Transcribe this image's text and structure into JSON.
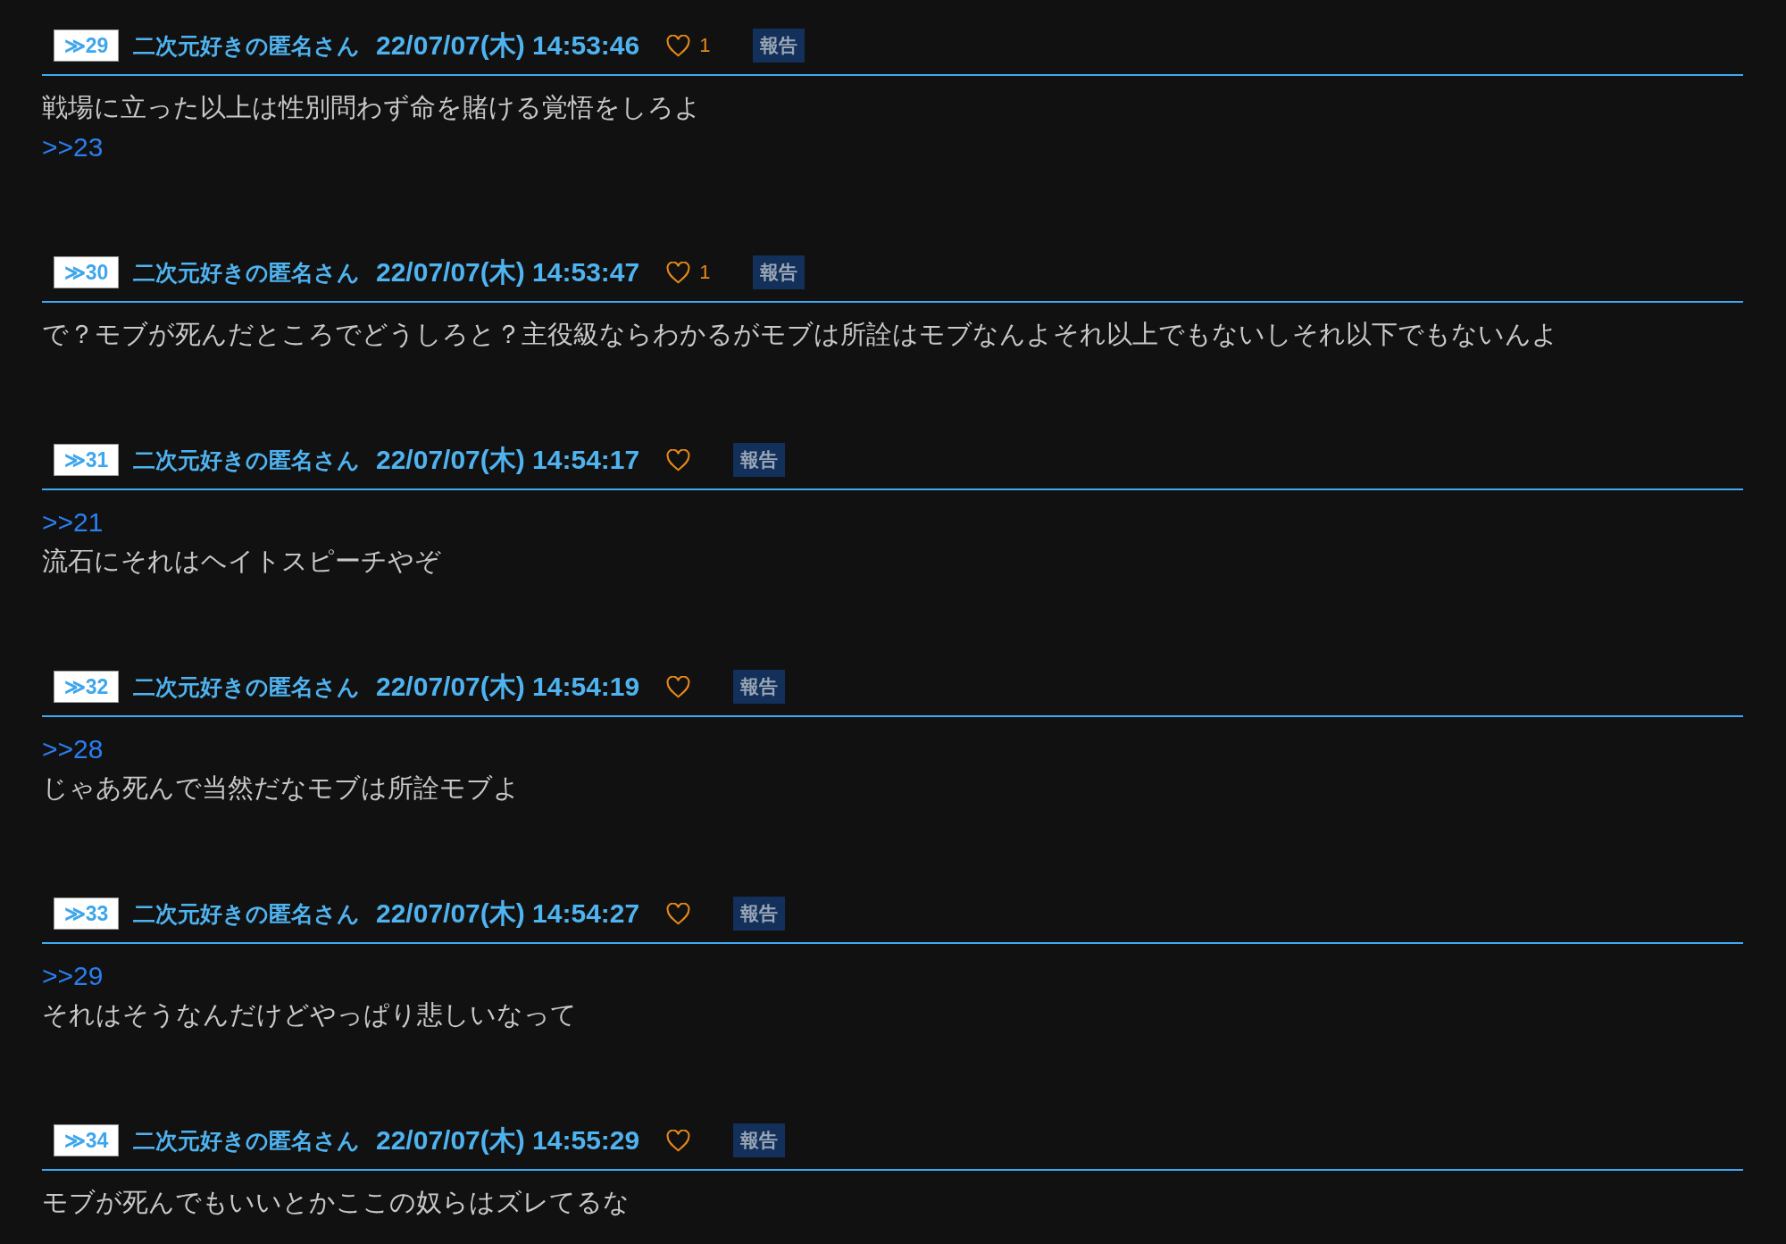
{
  "posts": [
    {
      "number": "≫29",
      "name": "二次元好きの匿名さん",
      "date": "22/07/07(木) 14:53:46",
      "likes": "1",
      "report": "報告",
      "lines": [
        {
          "kind": "text",
          "text": "戦場に立った以上は性別問わず命を賭ける覚悟をしろよ"
        },
        {
          "kind": "anchor",
          "text": ">>23"
        }
      ]
    },
    {
      "number": "≫30",
      "name": "二次元好きの匿名さん",
      "date": "22/07/07(木) 14:53:47",
      "likes": "1",
      "report": "報告",
      "lines": [
        {
          "kind": "text",
          "text": "で？モブが死んだところでどうしろと？主役級ならわかるがモブは所詮はモブなんよそれ以上でもないしそれ以下でもないんよ"
        }
      ]
    },
    {
      "number": "≫31",
      "name": "二次元好きの匿名さん",
      "date": "22/07/07(木) 14:54:17",
      "report": "報告",
      "lines": [
        {
          "kind": "anchor",
          "text": ">>21"
        },
        {
          "kind": "text",
          "text": "流石にそれはヘイトスピーチやぞ"
        }
      ]
    },
    {
      "number": "≫32",
      "name": "二次元好きの匿名さん",
      "date": "22/07/07(木) 14:54:19",
      "report": "報告",
      "lines": [
        {
          "kind": "anchor",
          "text": ">>28"
        },
        {
          "kind": "text",
          "text": "じゃあ死んで当然だなモブは所詮モブよ"
        }
      ]
    },
    {
      "number": "≫33",
      "name": "二次元好きの匿名さん",
      "date": "22/07/07(木) 14:54:27",
      "report": "報告",
      "lines": [
        {
          "kind": "anchor",
          "text": ">>29"
        },
        {
          "kind": "text",
          "text": "それはそうなんだけどやっぱり悲しいなって"
        }
      ]
    },
    {
      "number": "≫34",
      "name": "二次元好きの匿名さん",
      "date": "22/07/07(木) 14:55:29",
      "report": "報告",
      "lines": [
        {
          "kind": "text",
          "text": "モブが死んでもいいとかここの奴らはズレてるな"
        }
      ]
    }
  ]
}
